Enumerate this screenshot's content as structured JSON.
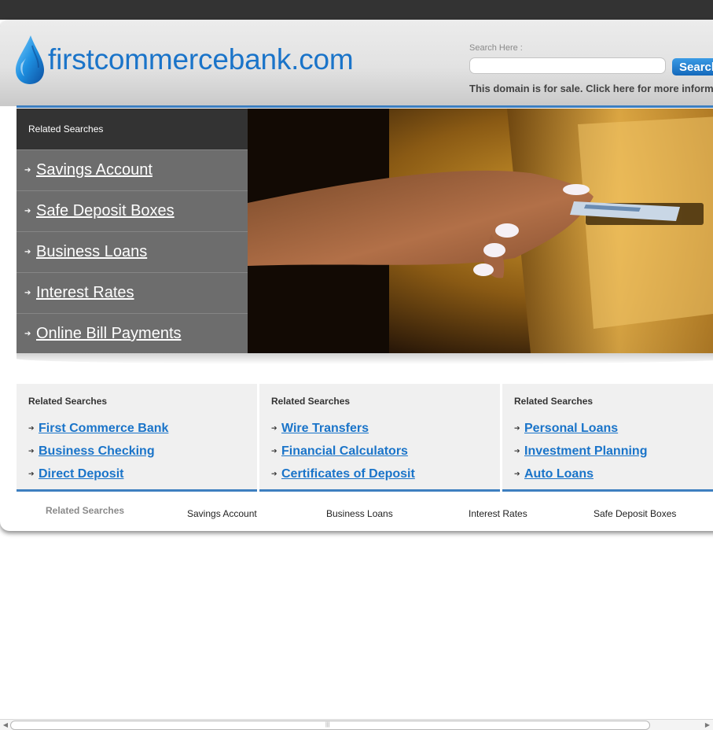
{
  "header": {
    "logo_text": "firstcommercebank.com",
    "search_label": "Search Here :",
    "search_placeholder": "",
    "search_value": "",
    "search_button": "Search",
    "sale_notice": "This domain is for sale. Click here for more information."
  },
  "sidebar": {
    "title": "Related Searches",
    "items": [
      {
        "label": "Savings Account"
      },
      {
        "label": "Safe Deposit Boxes"
      },
      {
        "label": "Business Loans"
      },
      {
        "label": "Interest Rates"
      },
      {
        "label": "Online Bill Payments"
      }
    ]
  },
  "boxes": [
    {
      "title": "Related Searches",
      "links": [
        "First Commerce Bank",
        "Business Checking",
        "Direct Deposit"
      ]
    },
    {
      "title": "Related Searches",
      "links": [
        "Wire Transfers",
        "Financial Calculators",
        "Certificates of Deposit"
      ]
    },
    {
      "title": "Related Searches",
      "links": [
        "Personal Loans",
        "Investment Planning",
        "Auto Loans"
      ]
    }
  ],
  "footer": {
    "title": "Related Searches",
    "links": [
      "Savings Account",
      "Business Loans",
      "Interest Rates",
      "Safe Deposit Boxes"
    ]
  },
  "colors": {
    "brand_blue": "#1a74c9",
    "accent_line": "#3d7fc0",
    "dark_bar": "#333333",
    "sidebar_gray": "#6d6d6d"
  },
  "icons": {
    "logo": "water-drop-icon",
    "bullet": "arrow-right-icon"
  }
}
